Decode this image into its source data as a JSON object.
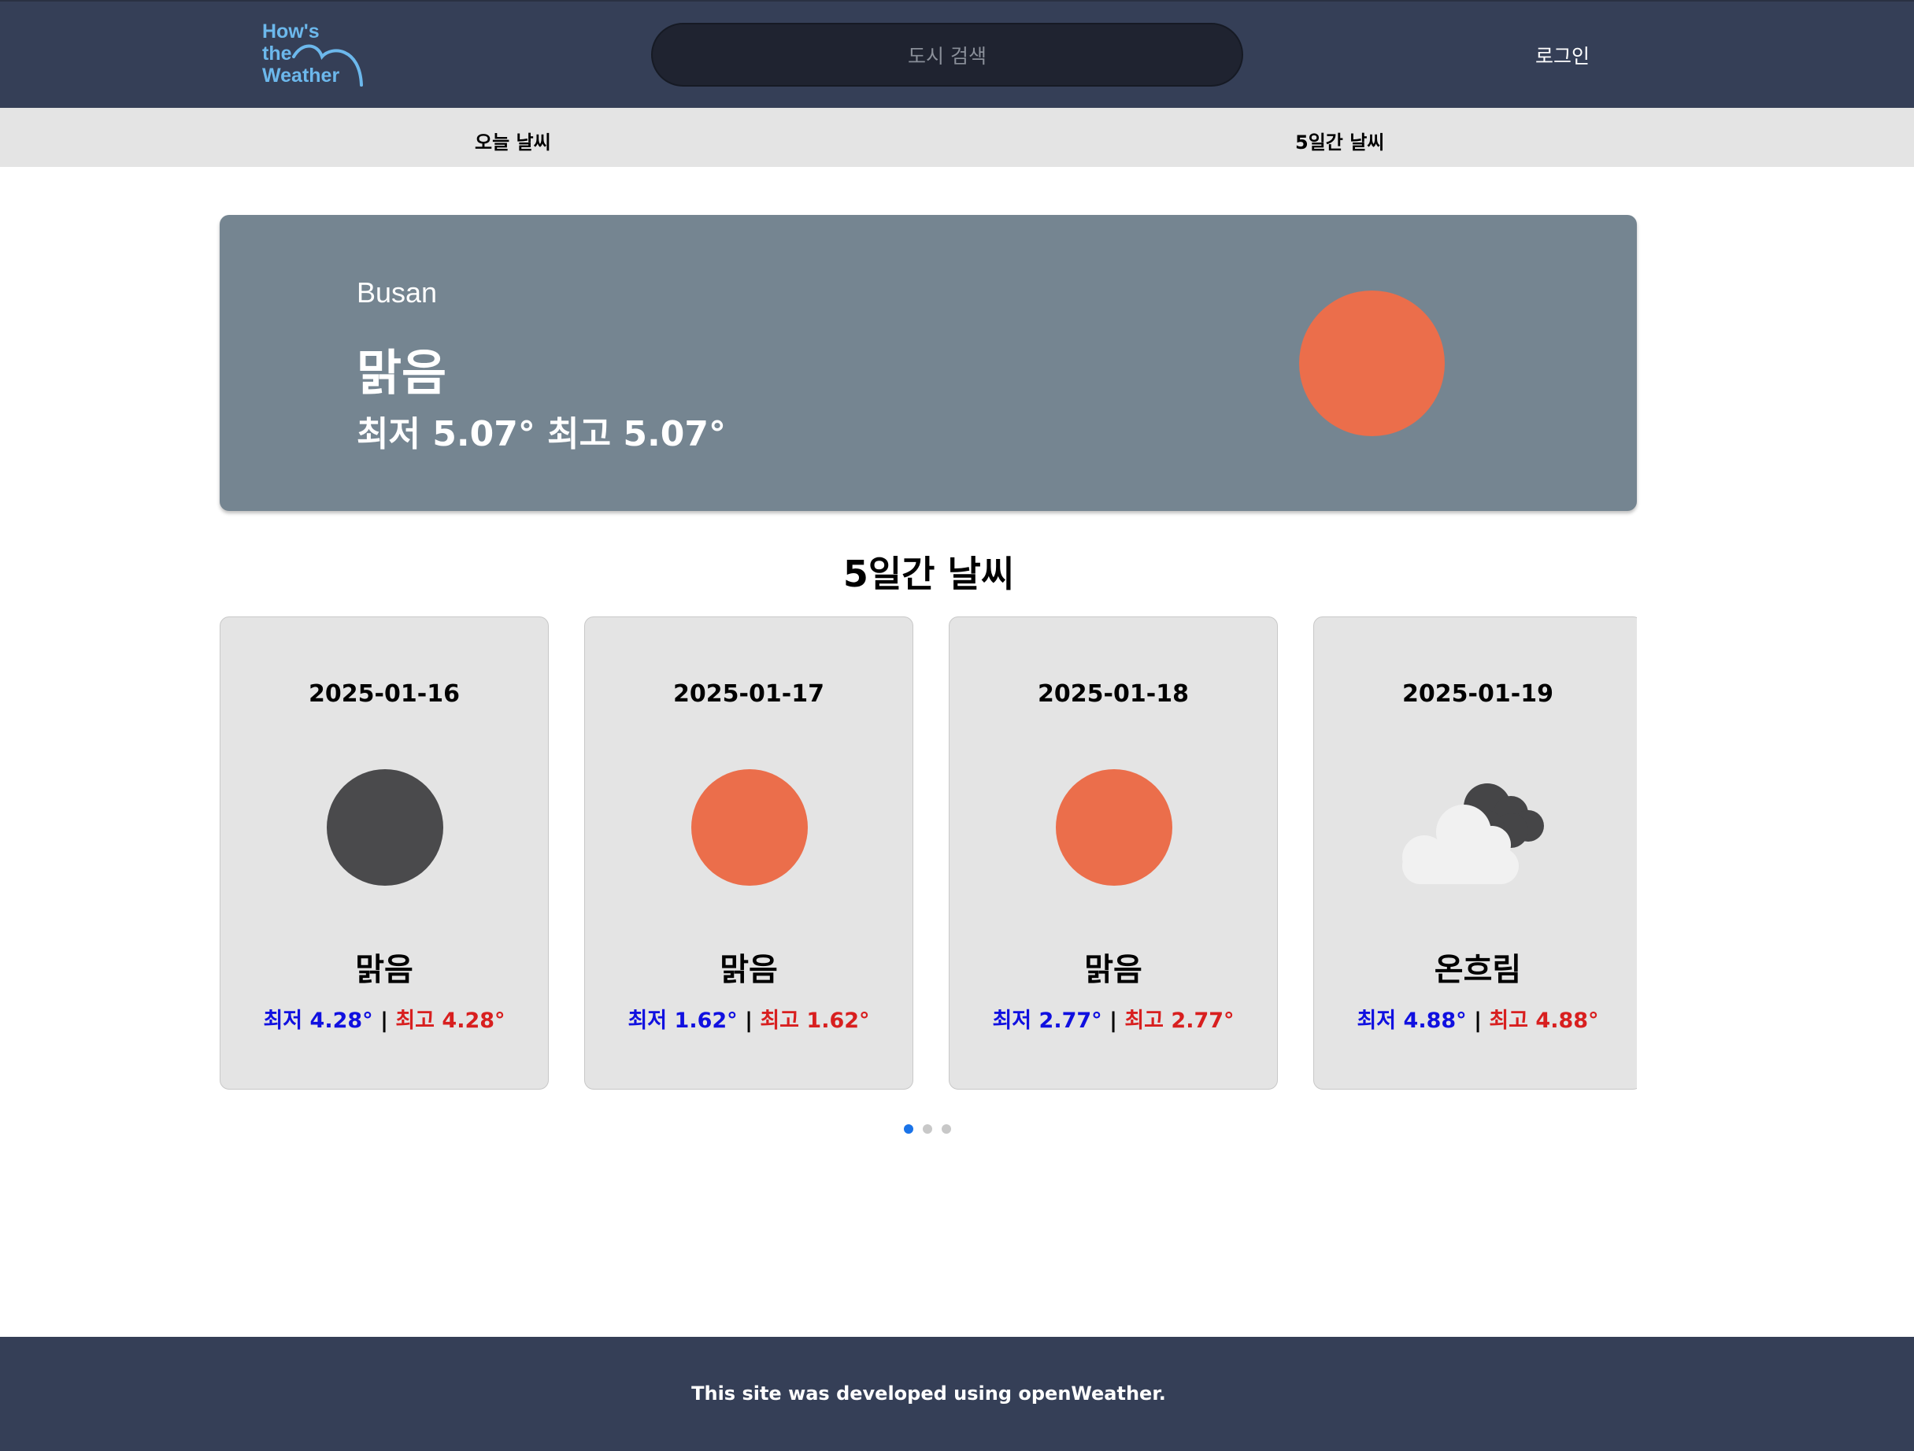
{
  "header": {
    "logo": {
      "line1": "How's",
      "line2": "the",
      "line3": "Weather"
    },
    "search": {
      "placeholder": "도시 검색"
    },
    "login_label": "로그인"
  },
  "tabs": [
    {
      "label": "오늘 날씨"
    },
    {
      "label": "5일간 날씨"
    }
  ],
  "today": {
    "city": "Busan",
    "description": "맑음",
    "temps": "최저 5.07° 최고 5.07°",
    "icon": "sun-icon"
  },
  "forecast": {
    "title": "5일간 날씨",
    "cards": [
      {
        "date": "2025-01-16",
        "icon": "moon-icon",
        "description": "맑음",
        "low": "최저 4.28°",
        "sep": "|",
        "high": "최고 4.28°"
      },
      {
        "date": "2025-01-17",
        "icon": "sun-icon",
        "description": "맑음",
        "low": "최저 1.62°",
        "sep": "|",
        "high": "최고 1.62°"
      },
      {
        "date": "2025-01-18",
        "icon": "sun-icon",
        "description": "맑음",
        "low": "최저 2.77°",
        "sep": "|",
        "high": "최고 2.77°"
      },
      {
        "date": "2025-01-19",
        "icon": "cloudy-icon",
        "description": "온흐림",
        "low": "최저 4.88°",
        "sep": "|",
        "high": "최고 4.88°"
      }
    ],
    "pagination": {
      "pages": 3,
      "active": 1
    }
  },
  "footer": {
    "text": "This site was developed using openWeather."
  },
  "colors": {
    "header_bg": "#353f57",
    "today_bg": "#758591",
    "sun": "#eb6e4b",
    "moon": "#4a4a4c",
    "low_temp": "#1010e0",
    "high_temp": "#d81f1f",
    "active_dot": "#1a73e8"
  }
}
